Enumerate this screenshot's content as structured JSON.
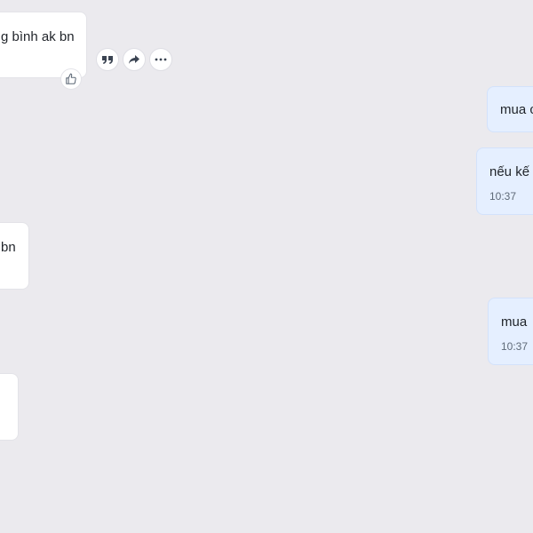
{
  "messages": {
    "m1": {
      "text": "g bình ak bn",
      "reaction": "thumbs-up-icon"
    },
    "m2": {
      "text": "mua c"
    },
    "m3": {
      "text": "nếu kế",
      "time": "10:37"
    },
    "m4": {
      "text": "bn"
    },
    "m5": {
      "text": "mua",
      "time": "10:37"
    },
    "m6": {
      "text": ""
    }
  },
  "message_actions": {
    "quote": "quote-icon",
    "forward": "share-icon",
    "more": "more-options-icon"
  },
  "colors": {
    "background": "#ebeaee",
    "incoming_bubble": "#ffffff",
    "outgoing_bubble": "#e5efff",
    "text": "#1f2329",
    "timestamp": "#5f6a78"
  }
}
